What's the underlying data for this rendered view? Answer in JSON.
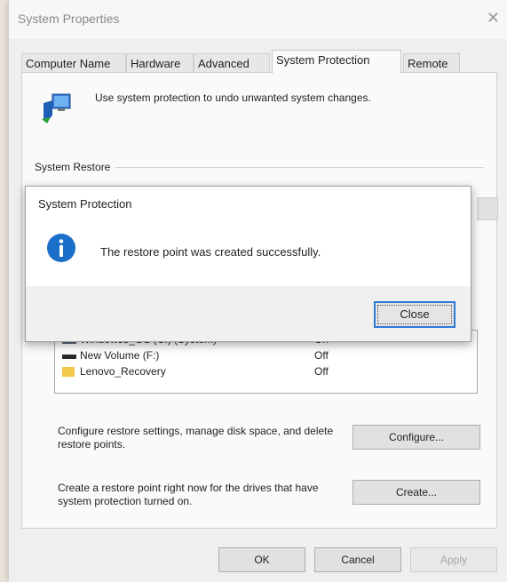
{
  "window": {
    "title": "System Properties",
    "close_glyph": "✕"
  },
  "tabs": [
    {
      "label": "Computer Name"
    },
    {
      "label": "Hardware"
    },
    {
      "label": "Advanced"
    },
    {
      "label": "System Protection",
      "active": true
    },
    {
      "label": "Remote"
    }
  ],
  "intro_text": "Use system protection to undo unwanted system changes.",
  "system_restore_group_label": "System Restore",
  "drives": [
    {
      "name": "Windows8_OS (C:) (System)",
      "status": "On",
      "icon": "system-drive-icon"
    },
    {
      "name": "New Volume (F:)",
      "status": "Off",
      "icon": "drive-icon"
    },
    {
      "name": "Lenovo_Recovery",
      "status": "Off",
      "icon": "folder-drive-icon"
    }
  ],
  "configure": {
    "description": "Configure restore settings, manage disk space, and delete restore points.",
    "button_label": "Configure..."
  },
  "create": {
    "description": "Create a restore point right now for the drives that have system protection turned on.",
    "button_label": "Create..."
  },
  "footer": {
    "ok_label": "OK",
    "cancel_label": "Cancel",
    "apply_label": "Apply"
  },
  "dialog": {
    "title": "System Protection",
    "message": "The restore point was created successfully.",
    "close_label": "Close",
    "icon": "info-icon"
  },
  "colors": {
    "accent": "#2c79d8",
    "info_blue": "#1a6fc9"
  }
}
